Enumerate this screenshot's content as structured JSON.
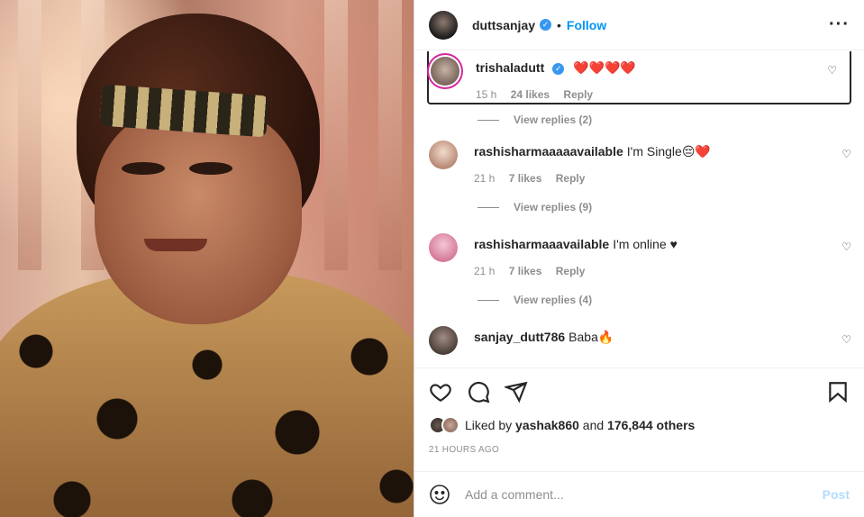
{
  "header": {
    "username": "duttsanjay",
    "separator": "•",
    "follow_label": "Follow",
    "more_icon": "more-horizontal-icon"
  },
  "comments": [
    {
      "username": "trishaladutt",
      "verified": true,
      "text": "❤️❤️❤️❤️",
      "time": "15 h",
      "likes": "24 likes",
      "reply": "Reply",
      "view_replies": "View replies (2)"
    },
    {
      "username": "rashisharmaaaaavailable",
      "text": "I'm Single😔❤️",
      "time": "21 h",
      "likes": "7 likes",
      "reply": "Reply",
      "view_replies": "View replies (9)"
    },
    {
      "username": "rashisharmaaavailable",
      "text": "I'm online ♥",
      "time": "21 h",
      "likes": "7 likes",
      "reply": "Reply",
      "view_replies": "View replies (4)"
    },
    {
      "username": "sanjay_dutt786",
      "text": "Baba🔥"
    }
  ],
  "actions": {
    "icons": [
      "heart-icon",
      "comment-icon",
      "share-icon",
      "bookmark-icon"
    ],
    "liked_by_prefix": "Liked by",
    "liked_by_user": "yashak860",
    "liked_by_and": "and",
    "liked_by_others": "176,844 others",
    "timestamp": "21 HOURS AGO"
  },
  "composer": {
    "placeholder": "Add a comment...",
    "post_label": "Post",
    "emoji_icon": "smiley-icon"
  },
  "colors": {
    "accent": "#0095f6",
    "verified": "#3897f0",
    "muted": "#8e8e8e",
    "post_disabled": "#b3dbff"
  }
}
